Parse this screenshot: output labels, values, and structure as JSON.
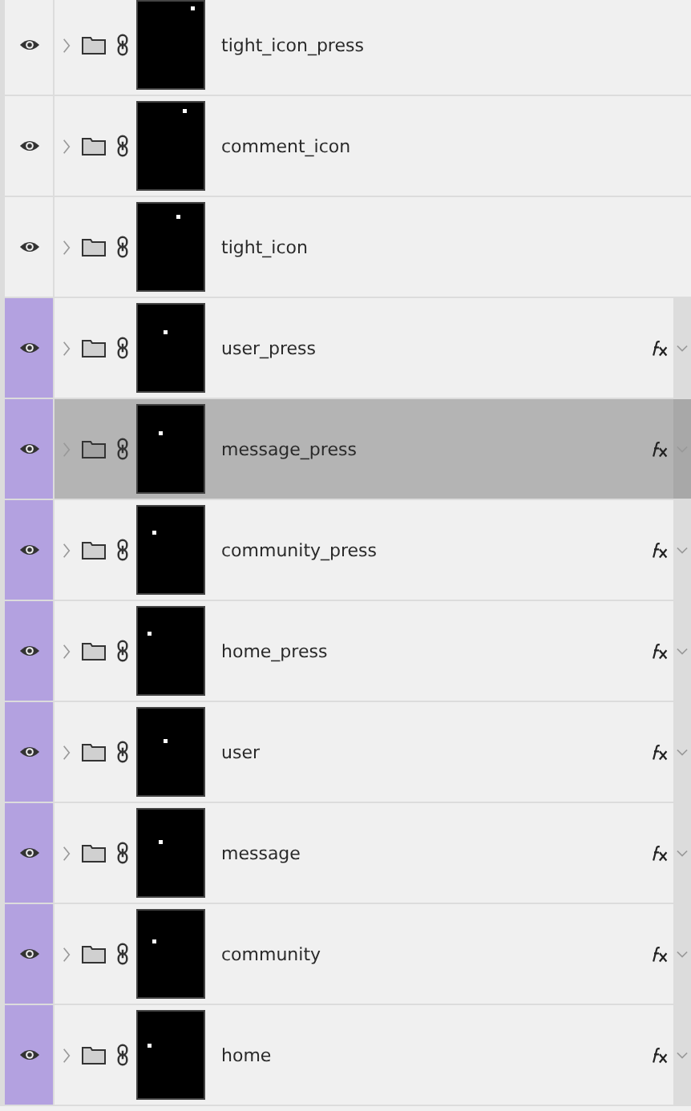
{
  "layers": [
    {
      "name": "tight_icon_press",
      "visible": true,
      "selected": false,
      "effects": false
    },
    {
      "name": "comment_icon",
      "visible": true,
      "selected": false,
      "effects": false
    },
    {
      "name": "tight_icon",
      "visible": true,
      "selected": false,
      "effects": false
    },
    {
      "name": "user_press",
      "visible": true,
      "selected": false,
      "effects": true,
      "color": "#b3a1e0"
    },
    {
      "name": "message_press",
      "visible": true,
      "selected": true,
      "effects": true,
      "color": "#b3a1e0"
    },
    {
      "name": "community_press",
      "visible": true,
      "selected": false,
      "effects": true,
      "color": "#b3a1e0"
    },
    {
      "name": "home_press",
      "visible": true,
      "selected": false,
      "effects": true,
      "color": "#b3a1e0"
    },
    {
      "name": "user",
      "visible": true,
      "selected": false,
      "effects": true,
      "color": "#b3a1e0"
    },
    {
      "name": "message",
      "visible": true,
      "selected": false,
      "effects": true,
      "color": "#b3a1e0"
    },
    {
      "name": "community",
      "visible": true,
      "selected": false,
      "effects": true,
      "color": "#b3a1e0"
    },
    {
      "name": "home",
      "visible": true,
      "selected": false,
      "effects": true,
      "color": "#b3a1e0"
    }
  ]
}
